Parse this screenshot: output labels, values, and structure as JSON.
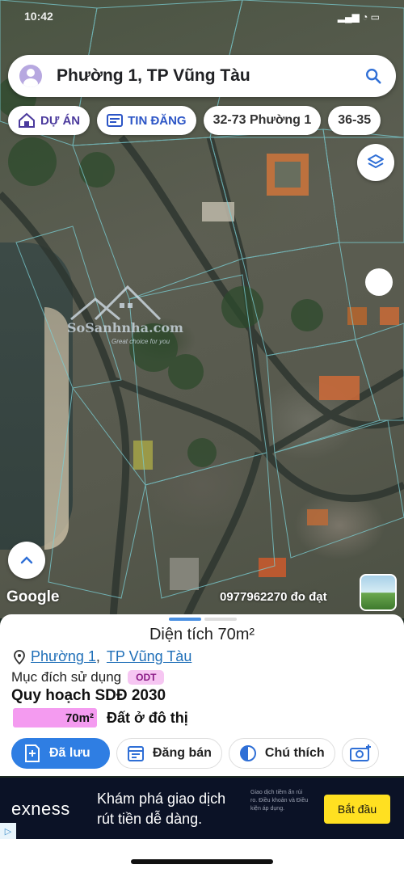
{
  "status": {
    "time": "10:42"
  },
  "search": {
    "text": "Phường 1, TP Vũng Tàu"
  },
  "chips": [
    {
      "label": "DỰ ÁN",
      "icon": "home-icon"
    },
    {
      "label": "TIN ĐĂNG",
      "icon": "listing-icon"
    },
    {
      "label": "32-73 Phường 1"
    },
    {
      "label": "36-35"
    }
  ],
  "map": {
    "watermark_brand": "SoSanhnha.com",
    "watermark_tagline": "Great choice for you",
    "attribution": "Google",
    "phone_note": "0977962270 đo đạt"
  },
  "sheet": {
    "area": "Diện tích 70m²",
    "ward": "Phường 1",
    "separator": ",",
    "city": "TP Vũng Tàu",
    "purpose_label": "Mục đích sử dụng",
    "purpose_code": "ODT",
    "plan_title": "Quy hoạch SDĐ 2030",
    "plan_area": "70m²",
    "plan_label": "Đất ở đô thị",
    "plan_color": "#f49bf0"
  },
  "actions": [
    {
      "label": "Đã lưu",
      "icon": "bookmark-plus-icon"
    },
    {
      "label": "Đăng bán",
      "icon": "calendar-icon"
    },
    {
      "label": "Chú thích",
      "icon": "half-circle-icon"
    }
  ],
  "ad": {
    "brand": "exness",
    "line1": "Khám phá giao dịch",
    "line2": "rút tiền dễ dàng.",
    "fine_print": "Giao dịch tiềm ẩn rủi ro. Điều khoản và Điều kiện áp dụng.",
    "cta": "Bắt đầu",
    "info": "▷"
  }
}
